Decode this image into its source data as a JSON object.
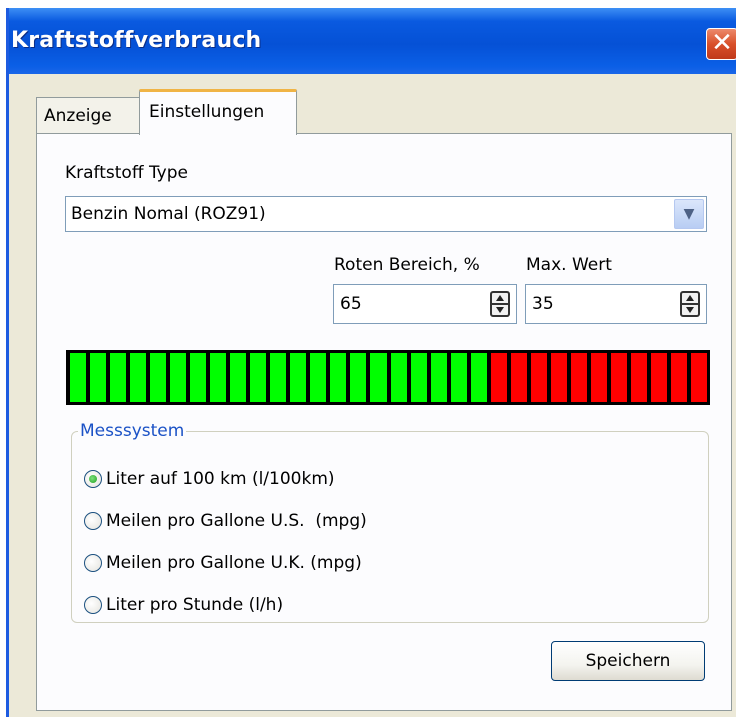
{
  "window": {
    "title": "Kraftstoffverbrauch",
    "close_glyph": "✕"
  },
  "tabs": [
    {
      "label": "Anzeige",
      "active": false
    },
    {
      "label": "Einstellungen",
      "active": true
    }
  ],
  "fuel_type": {
    "label": "Kraftstoff Type",
    "value": "Benzin Nomal (ROZ91)"
  },
  "red_zone": {
    "label": "Roten Bereich, %",
    "value": "65"
  },
  "max_value": {
    "label": "Max. Wert",
    "value": "35"
  },
  "gauge": {
    "total_segments": 32,
    "green_segments": 21,
    "green_color": "#00ff00",
    "red_color": "#ff0000"
  },
  "measurement": {
    "legend": "Messsystem",
    "options": [
      {
        "label": "Liter auf 100 km (l/100km)",
        "selected": true
      },
      {
        "label": "Meilen pro Gallone U.S.  (mpg)",
        "selected": false
      },
      {
        "label": "Meilen pro Gallone U.K. (mpg)",
        "selected": false
      },
      {
        "label": "Liter pro Stunde (l/h)",
        "selected": false
      }
    ]
  },
  "save_button": {
    "label": "Speichern"
  },
  "icons": {
    "dropdown": "chevron-down-icon",
    "spinner": "spinner-arrows-icon",
    "close": "close-icon"
  }
}
